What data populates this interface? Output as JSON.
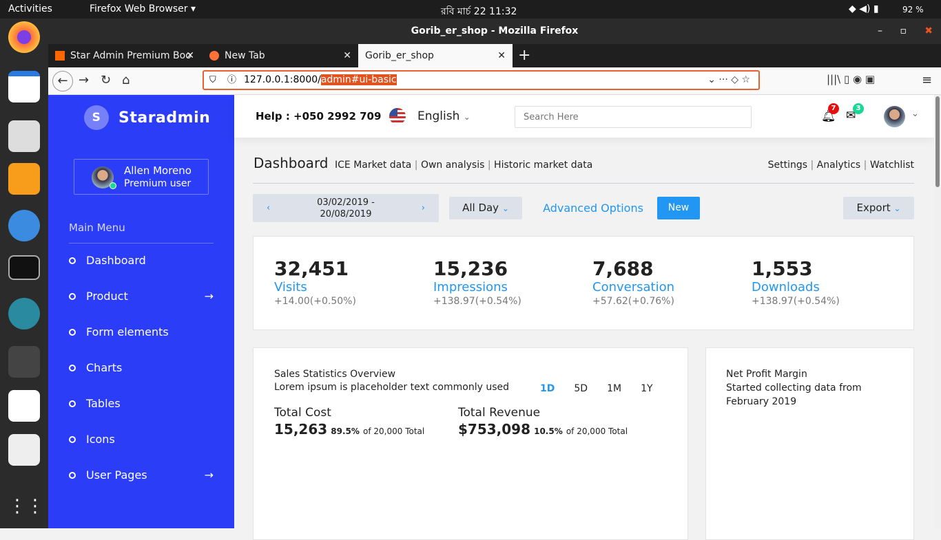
{
  "system": {
    "activities": "Activities",
    "app_menu": "Firefox Web Browser",
    "clock": "রবি মার্চ 22  11:32",
    "battery": "92 %"
  },
  "browser": {
    "window_title": "Gorib_er_shop - Mozilla Firefox",
    "tabs": [
      {
        "label": "Star Admin Premium Boo"
      },
      {
        "label": "New Tab"
      },
      {
        "label": "Gorib_er_shop"
      }
    ],
    "url_base": "127.0.0.1:8000/",
    "url_selected": "admin#ui-basic"
  },
  "sidebar": {
    "brand": "Staradmin",
    "brand_initial": "S",
    "user_name": "Allen Moreno",
    "user_role": "Premium user",
    "menu_title": "Main Menu",
    "items": [
      {
        "label": "Dashboard"
      },
      {
        "label": "Product"
      },
      {
        "label": "Form elements"
      },
      {
        "label": "Charts"
      },
      {
        "label": "Tables"
      },
      {
        "label": "Icons"
      },
      {
        "label": "User Pages"
      }
    ]
  },
  "header": {
    "help": "Help : +050 2992 709",
    "language": "English",
    "search_placeholder": "Search Here",
    "notifications": "7",
    "messages": "3"
  },
  "page": {
    "title": "Dashboard",
    "links": [
      "ICE Market data",
      "Own analysis",
      "Historic market data"
    ],
    "right_links": [
      "Settings",
      "Analytics",
      "Watchlist"
    ],
    "date_range_1": "03/02/2019 -",
    "date_range_2": "20/08/2019",
    "period": "All Day",
    "advanced": "Advanced Options",
    "new": "New",
    "export": "Export"
  },
  "stats": [
    {
      "value": "32,451",
      "label": "Visits",
      "change": "+14.00(+0.50%)"
    },
    {
      "value": "15,236",
      "label": "Impressions",
      "change": "+138.97(+0.54%)"
    },
    {
      "value": "7,688",
      "label": "Conversation",
      "change": "+57.62(+0.76%)"
    },
    {
      "value": "1,553",
      "label": "Downloads",
      "change": "+138.97(+0.54%)"
    }
  ],
  "sales": {
    "title": "Sales Statistics Overview",
    "subtitle": "Lorem ipsum is placeholder text commonly used",
    "ranges": [
      "1D",
      "5D",
      "1M",
      "1Y"
    ],
    "cost_label": "Total Cost",
    "cost_value": "15,263",
    "cost_pct": "89.5%",
    "cost_of": "of 20,000 Total",
    "rev_label": "Total Revenue",
    "rev_value": "$753,098",
    "rev_pct": "10.5%",
    "rev_of": "of 20,000 Total"
  },
  "profit": {
    "title": "Net Profit Margin",
    "line1": "Started collecting data from",
    "line2": "February 2019"
  }
}
